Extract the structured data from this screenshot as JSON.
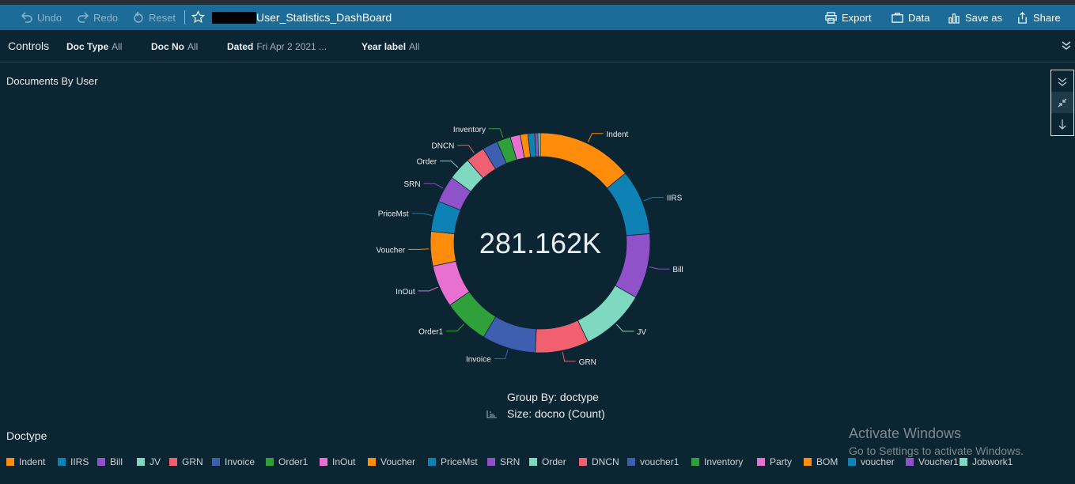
{
  "toolbar": {
    "undo": "Undo",
    "redo": "Redo",
    "reset": "Reset",
    "title": "User_Statistics_DashBoard",
    "export": "Export",
    "data": "Data",
    "save_as": "Save as",
    "share": "Share"
  },
  "controls": {
    "label": "Controls",
    "items": [
      {
        "name": "Doc Type",
        "value": "All"
      },
      {
        "name": "Doc No",
        "value": "All"
      },
      {
        "name": "Dated",
        "value": "Fri Apr 2 2021 ..."
      },
      {
        "name": "Year label",
        "value": "All"
      }
    ]
  },
  "visual": {
    "title": "Documents By User",
    "center_value": "281.162K",
    "group_by": "Group By: doctype",
    "size_by": "Size: docno (Count)"
  },
  "legend": {
    "title": "Doctype"
  },
  "windows": {
    "line1": "Activate Windows",
    "line2": "Go to Settings to activate Windows."
  },
  "chart_data": {
    "type": "pie",
    "donut": true,
    "total_label": "281.162K",
    "categories": [
      "Indent",
      "IIRS",
      "Bill",
      "JV",
      "GRN",
      "Invoice",
      "Order1",
      "InOut",
      "Voucher",
      "PriceMst",
      "SRN",
      "Order",
      "DNCN",
      "voucher1",
      "Inventory",
      "Party",
      "BOM",
      "voucher",
      "Voucher1",
      "Jobwork1"
    ],
    "values": [
      12.5,
      8.5,
      8.5,
      8.5,
      7.0,
      7.0,
      6.0,
      5.5,
      4.5,
      4.0,
      3.5,
      3.0,
      2.5,
      2.0,
      1.8,
      1.3,
      1.0,
      0.9,
      0.4,
      0.3
    ],
    "colors": [
      "#ff8c0a",
      "#0e82b4",
      "#8f52c8",
      "#7fd8c0",
      "#f06070",
      "#3e5fb0",
      "#2fa03a",
      "#e870d0",
      "#ff8c0a",
      "#0e82b4",
      "#8f52c8",
      "#7fd8c0",
      "#f06070",
      "#3e5fb0",
      "#2fa03a",
      "#e870d0",
      "#ff8c0a",
      "#0e82b4",
      "#8f52c8",
      "#7fd8c0"
    ],
    "labeled": [
      "Indent",
      "IIRS",
      "Bill",
      "JV",
      "GRN",
      "Invoice",
      "Order1",
      "InOut",
      "Voucher",
      "PriceMst",
      "SRN",
      "Order",
      "DNCN",
      "Inventory"
    ],
    "legend_placement": "bottom"
  }
}
